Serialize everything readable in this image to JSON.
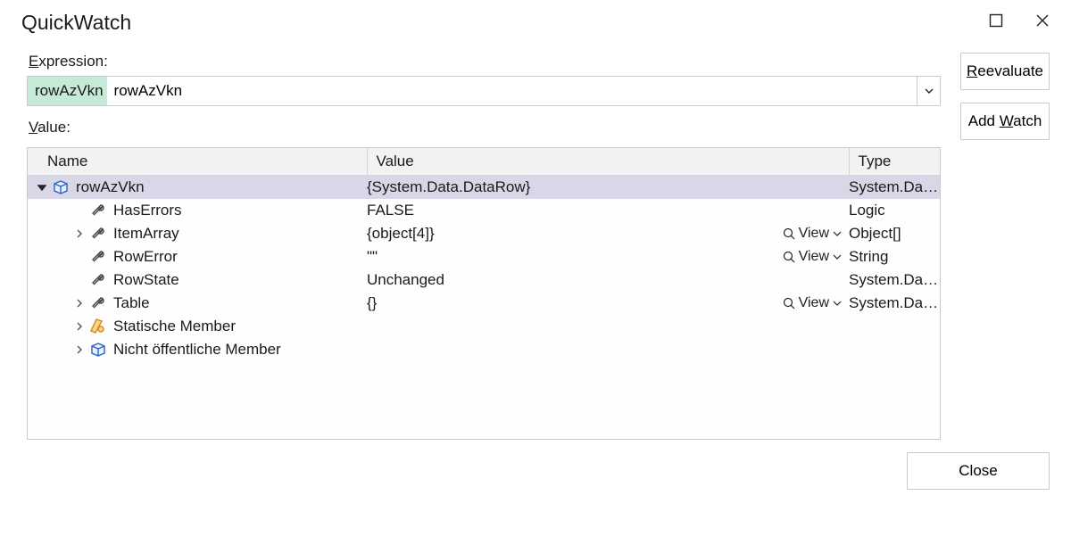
{
  "window": {
    "title": "QuickWatch"
  },
  "labels": {
    "expression_prefix": "E",
    "expression_rest": "xpression:",
    "value_prefix": "V",
    "value_rest": "alue:"
  },
  "buttons": {
    "reevaluate_prefix": "R",
    "reevaluate_rest": "eevaluate",
    "addwatch_pre": "Add ",
    "addwatch_mn": "W",
    "addwatch_post": "atch",
    "close": "Close",
    "view": "View"
  },
  "expression": {
    "value": "rowAzVkn"
  },
  "grid": {
    "headers": {
      "name": "Name",
      "value": "Value",
      "type": "Type"
    },
    "rows": [
      {
        "indent": 0,
        "expander": "expanded",
        "icon": "cube",
        "name": "rowAzVkn",
        "value": "{System.Data.DataRow}",
        "type": "System.Data.DataRow",
        "selected": true,
        "view": false
      },
      {
        "indent": 1,
        "expander": "none",
        "icon": "wrench",
        "name": "HasErrors",
        "value": "FALSE",
        "type": "Logic",
        "selected": false,
        "view": false
      },
      {
        "indent": 1,
        "expander": "collapsed",
        "icon": "wrench",
        "name": "ItemArray",
        "value": "{object[4]}",
        "type": "Object[]",
        "selected": false,
        "view": true
      },
      {
        "indent": 1,
        "expander": "none",
        "icon": "wrench",
        "name": "RowError",
        "value": "\"\"",
        "type": "String",
        "selected": false,
        "view": true
      },
      {
        "indent": 1,
        "expander": "none",
        "icon": "wrench",
        "name": "RowState",
        "value": "Unchanged",
        "type": "System.Data.DataRo…",
        "selected": false,
        "view": false
      },
      {
        "indent": 1,
        "expander": "collapsed",
        "icon": "wrench",
        "name": "Table",
        "value": "{}",
        "type": "System.Data.DataTa…",
        "selected": false,
        "view": true
      },
      {
        "indent": 1,
        "expander": "collapsed",
        "icon": "key",
        "name": "Statische Member",
        "value": "",
        "type": "",
        "selected": false,
        "view": false
      },
      {
        "indent": 1,
        "expander": "collapsed",
        "icon": "cube2",
        "name": "Nicht öffentliche Member",
        "value": "",
        "type": "",
        "selected": false,
        "view": false
      }
    ]
  }
}
